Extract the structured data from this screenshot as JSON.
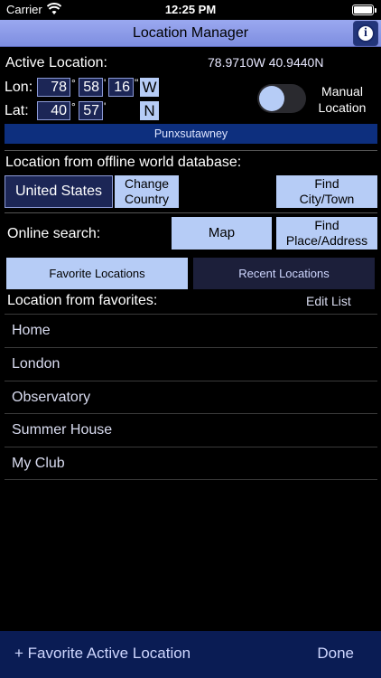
{
  "status_bar": {
    "carrier": "Carrier",
    "time": "12:25 PM",
    "battery_level": 1.0
  },
  "header": {
    "title": "Location Manager",
    "info_icon": "info-icon"
  },
  "active_location": {
    "label": "Active Location:",
    "coordinates": "78.9710W 40.9440N",
    "lon_label": "Lon:",
    "lon_deg": "78",
    "lon_min": "58",
    "lon_sec": "16",
    "lon_hemi": "W",
    "lat_label": "Lat:",
    "lat_deg": "40",
    "lat_min": "57",
    "lat_hemi": "N",
    "deg_symbol": "°",
    "min_symbol": "'",
    "sec_symbol": "\"",
    "manual_label_1": "Manual",
    "manual_label_2": "Location",
    "manual_on": false,
    "place_name": "Punxsutawney"
  },
  "offline": {
    "label": "Location from offline world database:",
    "country": "United States",
    "change_country_1": "Change",
    "change_country_2": "Country",
    "find_city_1": "Find",
    "find_city_2": "City/Town"
  },
  "online": {
    "label": "Online search:",
    "map_button": "Map",
    "find_place_1": "Find",
    "find_place_2": "Place/Address"
  },
  "tabs": {
    "favorites": "Favorite Locations",
    "recent": "Recent Locations"
  },
  "favorites": {
    "label": "Location from favorites:",
    "edit_list": "Edit List",
    "items": [
      "Home",
      "London",
      "Observatory",
      "Summer House",
      "My Club"
    ]
  },
  "footer": {
    "add_favorite": "+ Favorite Active Location",
    "done": "Done"
  },
  "colors": {
    "title_bar": "#8a98e8",
    "accent_light": "#b6ccf6",
    "field_dark": "#1c2656",
    "place_bar": "#0d2f7e",
    "footer": "#0a1c54"
  }
}
